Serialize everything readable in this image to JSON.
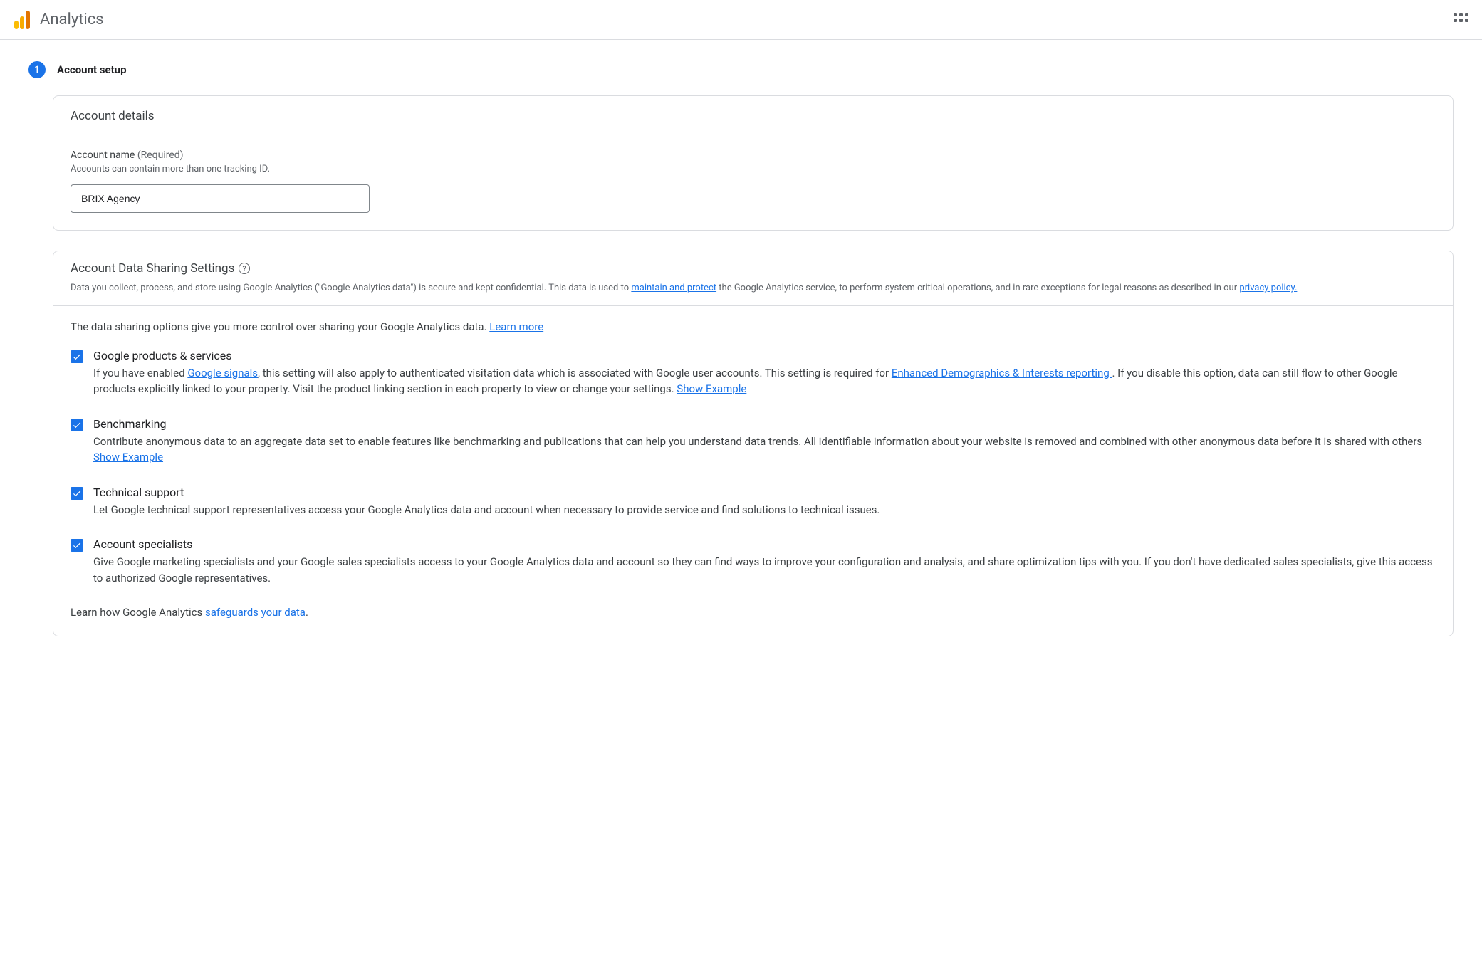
{
  "app_title": "Analytics",
  "step": {
    "number": "1",
    "title": "Account setup"
  },
  "account_details": {
    "card_title": "Account details",
    "field_label": "Account name",
    "required_tag": "(Required)",
    "field_hint": "Accounts can contain more than one tracking ID.",
    "value": "BRIX Agency"
  },
  "sharing": {
    "title": "Account Data Sharing Settings",
    "desc_part1": "Data you collect, process, and store using Google Analytics (\"Google Analytics data\") is secure and kept confidential. This data is used to ",
    "link_maintain": "maintain and protect",
    "desc_part2": " the Google Analytics service, to perform system critical operations, and in rare exceptions for legal reasons as described in our ",
    "link_privacy": "privacy policy.",
    "intro_text": "The data sharing options give you more control over sharing your Google Analytics data. ",
    "learn_more": "Learn more",
    "items": [
      {
        "title": "Google products & services",
        "d1": "If you have enabled ",
        "l1": "Google signals",
        "d2": ", this setting will also apply to authenticated visitation data which is associated with Google user accounts. This setting is required for ",
        "l2": "Enhanced Demographics & Interests reporting ",
        "d3": ". If you disable this option, data can still flow to other Google products explicitly linked to your property. Visit the product linking section in each property to view or change your settings. ",
        "l3": "Show Example"
      },
      {
        "title": "Benchmarking",
        "d1": "Contribute anonymous data to an aggregate data set to enable features like benchmarking and publications that can help you understand data trends. All identifiable information about your website is removed and combined with other anonymous data before it is shared with others ",
        "l1": "Show Example"
      },
      {
        "title": "Technical support",
        "d1": "Let Google technical support representatives access your Google Analytics data and account when necessary to provide service and find solutions to technical issues."
      },
      {
        "title": "Account specialists",
        "d1": "Give Google marketing specialists and your Google sales specialists access to your Google Analytics data and account so they can find ways to improve your configuration and analysis, and share optimization tips with you. If you don't have dedicated sales specialists, give this access to authorized Google representatives."
      }
    ],
    "footer_text": "Learn how Google Analytics ",
    "footer_link": "safeguards your data",
    "footer_end": "."
  }
}
